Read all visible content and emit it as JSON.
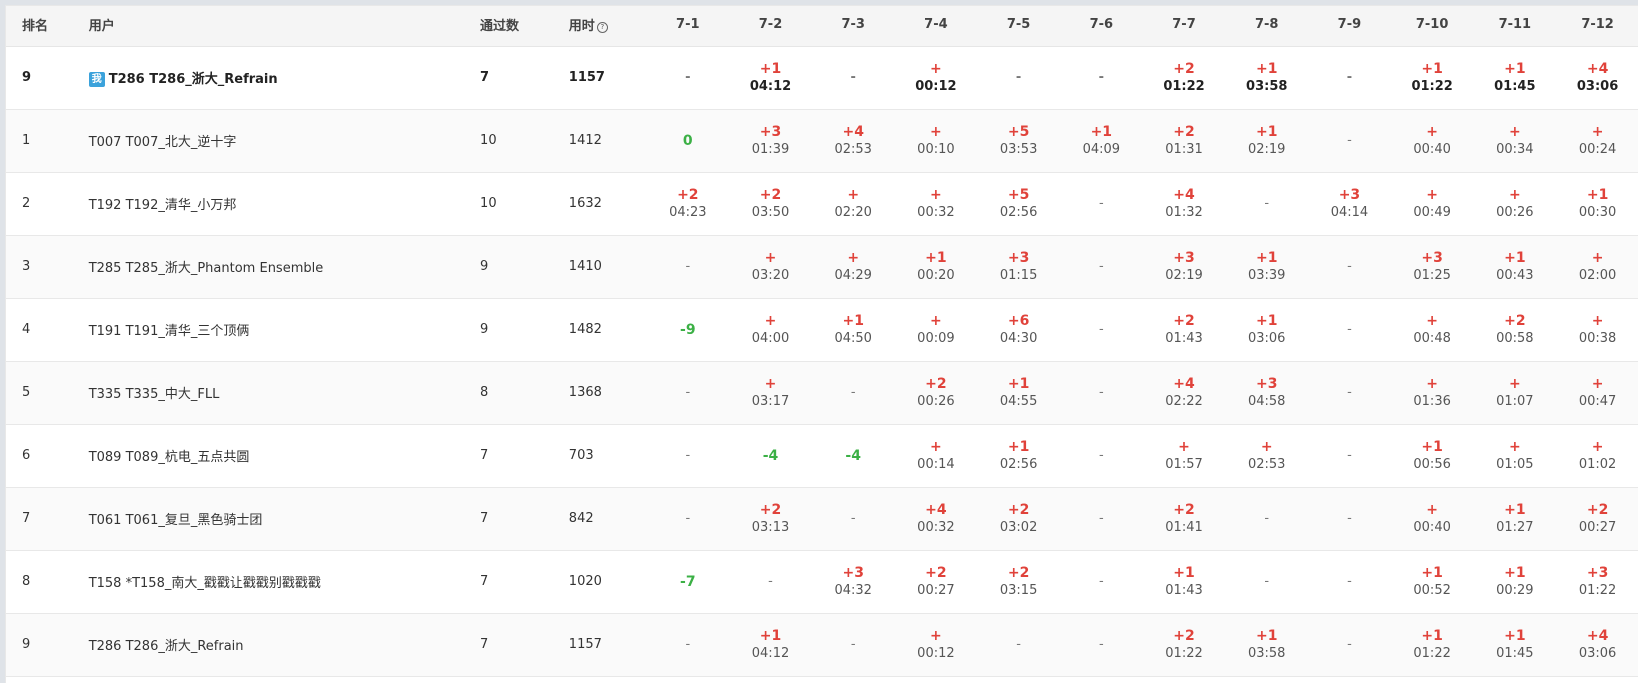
{
  "headers": {
    "rank": "排名",
    "user": "用户",
    "solved": "通过数",
    "time": "用时",
    "problems": [
      "7-1",
      "7-2",
      "7-3",
      "7-4",
      "7-5",
      "7-6",
      "7-7",
      "7-8",
      "7-9",
      "7-10",
      "7-11",
      "7-12"
    ]
  },
  "me_badge": "我",
  "colors": {
    "accepted": "#e0423a",
    "failed": "#3bb045",
    "badge": "#3ba2db"
  },
  "rows": [
    {
      "rank": "9",
      "user": "T286 T286_浙大_Refrain",
      "solved": "7",
      "time": "1157",
      "me": true,
      "cells": [
        {
          "t": "-"
        },
        {
          "a": "+1",
          "tm": "04:12"
        },
        {
          "t": "-"
        },
        {
          "a": "+",
          "tm": "00:12"
        },
        {
          "t": "-"
        },
        {
          "t": "-"
        },
        {
          "a": "+2",
          "tm": "01:22"
        },
        {
          "a": "+1",
          "tm": "03:58"
        },
        {
          "t": "-"
        },
        {
          "a": "+1",
          "tm": "01:22"
        },
        {
          "a": "+1",
          "tm": "01:45"
        },
        {
          "a": "+4",
          "tm": "03:06"
        }
      ]
    },
    {
      "rank": "1",
      "user": "T007 T007_北大_逆十字",
      "solved": "10",
      "time": "1412",
      "cells": [
        {
          "f": "0"
        },
        {
          "a": "+3",
          "tm": "01:39"
        },
        {
          "a": "+4",
          "tm": "02:53"
        },
        {
          "a": "+",
          "tm": "00:10"
        },
        {
          "a": "+5",
          "tm": "03:53"
        },
        {
          "a": "+1",
          "tm": "04:09"
        },
        {
          "a": "+2",
          "tm": "01:31"
        },
        {
          "a": "+1",
          "tm": "02:19"
        },
        {
          "t": "-"
        },
        {
          "a": "+",
          "tm": "00:40"
        },
        {
          "a": "+",
          "tm": "00:34"
        },
        {
          "a": "+",
          "tm": "00:24"
        }
      ]
    },
    {
      "rank": "2",
      "user": "T192 T192_清华_小万邦",
      "solved": "10",
      "time": "1632",
      "cells": [
        {
          "a": "+2",
          "tm": "04:23"
        },
        {
          "a": "+2",
          "tm": "03:50"
        },
        {
          "a": "+",
          "tm": "02:20"
        },
        {
          "a": "+",
          "tm": "00:32"
        },
        {
          "a": "+5",
          "tm": "02:56"
        },
        {
          "t": "-"
        },
        {
          "a": "+4",
          "tm": "01:32"
        },
        {
          "t": "-"
        },
        {
          "a": "+3",
          "tm": "04:14"
        },
        {
          "a": "+",
          "tm": "00:49"
        },
        {
          "a": "+",
          "tm": "00:26"
        },
        {
          "a": "+1",
          "tm": "00:30"
        }
      ]
    },
    {
      "rank": "3",
      "user": "T285 T285_浙大_Phantom Ensemble",
      "solved": "9",
      "time": "1410",
      "cells": [
        {
          "t": "-"
        },
        {
          "a": "+",
          "tm": "03:20"
        },
        {
          "a": "+",
          "tm": "04:29"
        },
        {
          "a": "+1",
          "tm": "00:20"
        },
        {
          "a": "+3",
          "tm": "01:15"
        },
        {
          "t": "-"
        },
        {
          "a": "+3",
          "tm": "02:19"
        },
        {
          "a": "+1",
          "tm": "03:39"
        },
        {
          "t": "-"
        },
        {
          "a": "+3",
          "tm": "01:25"
        },
        {
          "a": "+1",
          "tm": "00:43"
        },
        {
          "a": "+",
          "tm": "02:00"
        }
      ]
    },
    {
      "rank": "4",
      "user": "T191 T191_清华_三个顶俩",
      "solved": "9",
      "time": "1482",
      "cells": [
        {
          "f": "-9"
        },
        {
          "a": "+",
          "tm": "04:00"
        },
        {
          "a": "+1",
          "tm": "04:50"
        },
        {
          "a": "+",
          "tm": "00:09"
        },
        {
          "a": "+6",
          "tm": "04:30"
        },
        {
          "t": "-"
        },
        {
          "a": "+2",
          "tm": "01:43"
        },
        {
          "a": "+1",
          "tm": "03:06"
        },
        {
          "t": "-"
        },
        {
          "a": "+",
          "tm": "00:48"
        },
        {
          "a": "+2",
          "tm": "00:58"
        },
        {
          "a": "+",
          "tm": "00:38"
        }
      ]
    },
    {
      "rank": "5",
      "user": "T335 T335_中大_FLL",
      "solved": "8",
      "time": "1368",
      "cells": [
        {
          "t": "-"
        },
        {
          "a": "+",
          "tm": "03:17"
        },
        {
          "t": "-"
        },
        {
          "a": "+2",
          "tm": "00:26"
        },
        {
          "a": "+1",
          "tm": "04:55"
        },
        {
          "t": "-"
        },
        {
          "a": "+4",
          "tm": "02:22"
        },
        {
          "a": "+3",
          "tm": "04:58"
        },
        {
          "t": "-"
        },
        {
          "a": "+",
          "tm": "01:36"
        },
        {
          "a": "+",
          "tm": "01:07"
        },
        {
          "a": "+",
          "tm": "00:47"
        }
      ]
    },
    {
      "rank": "6",
      "user": "T089 T089_杭电_五点共圆",
      "solved": "7",
      "time": "703",
      "cells": [
        {
          "t": "-"
        },
        {
          "f": "-4"
        },
        {
          "f": "-4"
        },
        {
          "a": "+",
          "tm": "00:14"
        },
        {
          "a": "+1",
          "tm": "02:56"
        },
        {
          "t": "-"
        },
        {
          "a": "+",
          "tm": "01:57"
        },
        {
          "a": "+",
          "tm": "02:53"
        },
        {
          "t": "-"
        },
        {
          "a": "+1",
          "tm": "00:56"
        },
        {
          "a": "+",
          "tm": "01:05"
        },
        {
          "a": "+",
          "tm": "01:02"
        }
      ]
    },
    {
      "rank": "7",
      "user": "T061 T061_复旦_黑色骑士团",
      "solved": "7",
      "time": "842",
      "cells": [
        {
          "t": "-"
        },
        {
          "a": "+2",
          "tm": "03:13"
        },
        {
          "t": "-"
        },
        {
          "a": "+4",
          "tm": "00:32"
        },
        {
          "a": "+2",
          "tm": "03:02"
        },
        {
          "t": "-"
        },
        {
          "a": "+2",
          "tm": "01:41"
        },
        {
          "t": "-"
        },
        {
          "t": "-"
        },
        {
          "a": "+",
          "tm": "00:40"
        },
        {
          "a": "+1",
          "tm": "01:27"
        },
        {
          "a": "+2",
          "tm": "00:27"
        }
      ]
    },
    {
      "rank": "8",
      "user": "T158 *T158_南大_戳戳让戳戳别戳戳戳",
      "solved": "7",
      "time": "1020",
      "cells": [
        {
          "f": "-7"
        },
        {
          "t": "-"
        },
        {
          "a": "+3",
          "tm": "04:32"
        },
        {
          "a": "+2",
          "tm": "00:27"
        },
        {
          "a": "+2",
          "tm": "03:15"
        },
        {
          "t": "-"
        },
        {
          "a": "+1",
          "tm": "01:43"
        },
        {
          "t": "-"
        },
        {
          "t": "-"
        },
        {
          "a": "+1",
          "tm": "00:52"
        },
        {
          "a": "+1",
          "tm": "00:29"
        },
        {
          "a": "+3",
          "tm": "01:22"
        }
      ]
    },
    {
      "rank": "9",
      "user": "T286 T286_浙大_Refrain",
      "solved": "7",
      "time": "1157",
      "cells": [
        {
          "t": "-"
        },
        {
          "a": "+1",
          "tm": "04:12"
        },
        {
          "t": "-"
        },
        {
          "a": "+",
          "tm": "00:12"
        },
        {
          "t": "-"
        },
        {
          "t": "-"
        },
        {
          "a": "+2",
          "tm": "01:22"
        },
        {
          "a": "+1",
          "tm": "03:58"
        },
        {
          "t": "-"
        },
        {
          "a": "+1",
          "tm": "01:22"
        },
        {
          "a": "+1",
          "tm": "01:45"
        },
        {
          "a": "+4",
          "tm": "03:06"
        }
      ]
    }
  ]
}
